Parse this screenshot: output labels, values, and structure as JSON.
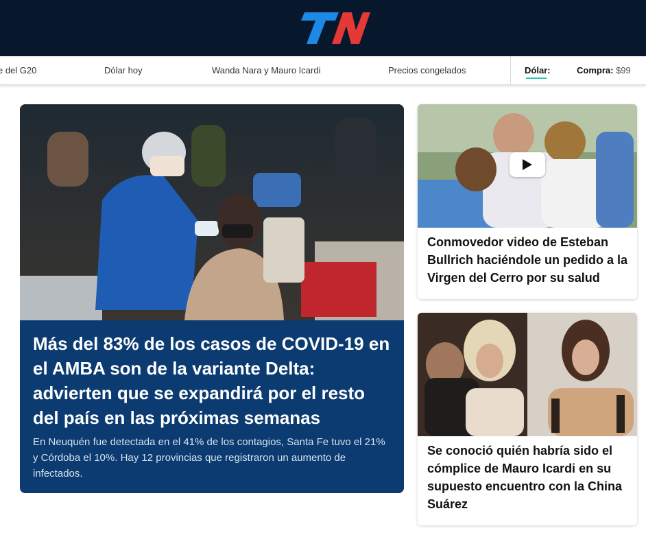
{
  "header": {
    "logo_text": "TN",
    "brand_colors": {
      "background": "#07182c",
      "logo_blue": "#1e88e5",
      "logo_red": "#e53935"
    }
  },
  "nav": {
    "links": [
      "e del G20",
      "Dólar hoy",
      "Wanda Nara y Mauro Icardi",
      "Precios congelados"
    ],
    "dolar_label": "Dólar:",
    "compra_label": "Compra:",
    "compra_value": "$99",
    "accent_color": "#2ec4b6"
  },
  "main_story": {
    "title": "Más del 83% de los casos de COVID-19 en el AMBA son de la variante Delta: advierten que se expandirá por el resto del país en las próximas semanas",
    "summary": "En Neuquén fue detectada en el 41% de los contagios, Santa Fe tuvo el 21% y Córdoba el 10%. Hay 12 provincias que registraron un aumento de infectados.",
    "background_color": "#0b3b70"
  },
  "side_stories": [
    {
      "title": "Conmovedor video de Esteban Bullrich haciéndole un pedido a la Virgen del Cerro por su salud",
      "has_video": true
    },
    {
      "title": "Se conoció quién habría sido el cómplice de Mauro Icardi en su supuesto encuentro con la China Suárez",
      "has_video": false
    }
  ]
}
